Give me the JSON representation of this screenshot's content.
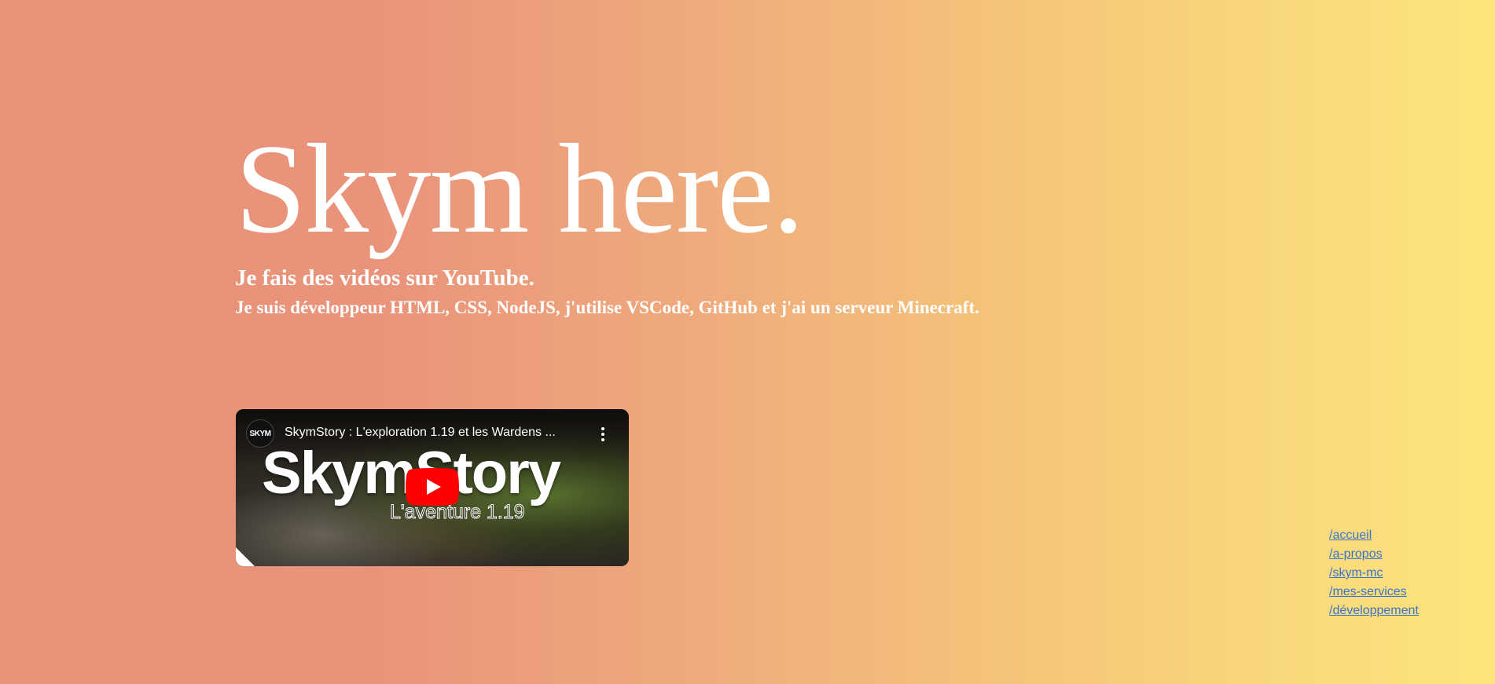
{
  "hero": {
    "title": "Skym here.",
    "line1": "Je fais des vidéos sur YouTube.",
    "line2": "Je suis développeur HTML, CSS, NodeJS, j'utilise VSCode, GitHub et j'ai un serveur Minecraft."
  },
  "video": {
    "channel_logo_text": "SKYM",
    "title": "SkymStory : L'exploration 1.19 et les Wardens ...",
    "thumbnail_title": "SkymStory",
    "thumbnail_subtitle": "L'aventure 1.19",
    "play_icon": "youtube-play-icon",
    "menu_icon": "more-vertical-icon"
  },
  "nav": {
    "items": [
      {
        "label": "/accueil"
      },
      {
        "label": "/a-propos"
      },
      {
        "label": "/skym-mc"
      },
      {
        "label": "/mes-services"
      },
      {
        "label": "/développement"
      }
    ]
  },
  "colors": {
    "gradient_start": "#e9927a",
    "gradient_end": "#fde57b",
    "text": "#ffffff",
    "link": "#3a74d0",
    "youtube_red": "#ff0000"
  }
}
